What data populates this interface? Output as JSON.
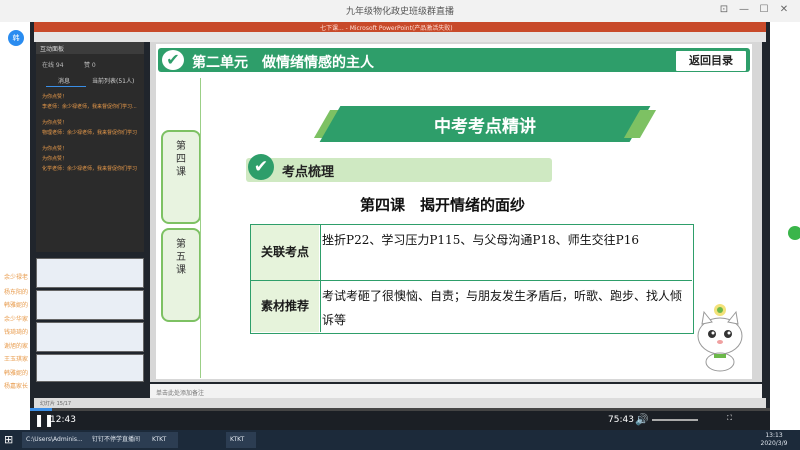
{
  "window": {
    "title": "九年级物化政史班级群直播",
    "pin": "⊡",
    "min": "—",
    "max": "☐",
    "close": "✕"
  },
  "user_avatar": "韩",
  "ppt": {
    "title": "七下课... - Microsoft PowerPoint(产品激活失败)"
  },
  "chat": {
    "header": "互动面板",
    "stats": {
      "users": "在线 94",
      "likes": "赞 0"
    },
    "tabs": [
      "消息",
      "当前列表(51人)"
    ],
    "messages": [
      "为你点赞！",
      "李老师：余少禄老师，我来督促你们学习...",
      "为你点赞！",
      "物理老师：余少禄老师，我来督促你们学习",
      "为你点赞！",
      "为你点赞！",
      "化学老师：余少禄老师，我来督促你们学习"
    ]
  },
  "slide": {
    "banner_title": "第二单元　做情绪情感的主人",
    "back_button": "返回目录",
    "tabs": [
      "第四课",
      "第五课"
    ],
    "heading": "中考考点精讲",
    "subheading": "考点梳理",
    "lesson_title": "第四课　揭开情绪的面纱",
    "table": {
      "rows": [
        {
          "header": "关联考点",
          "content": "挫折P22、学习压力P115、与父母沟通P18、师生交往P16"
        },
        {
          "header": "素材推荐",
          "content": "考试考砸了很懊恼、自责；与朋友发生矛盾后，听歌、跑步、找人倾诉等"
        }
      ]
    }
  },
  "notes": {
    "placeholder": "单击此处添加备注"
  },
  "statusbar": {
    "text": "幻灯片 15/17　"
  },
  "comments": {
    "names": [
      "余少禄老",
      "杨东阳的",
      "韩雅妮的",
      "余少华家",
      "钱琦琦的",
      "谢旭的家",
      "王玉琪家",
      "韩雅妮的",
      "杨嘉家长"
    ]
  },
  "player": {
    "current_time": "12:43",
    "total_time": "75:43",
    "progress": 0.03
  },
  "taskbar": {
    "items": [
      "C:\\Users\\Adminis...",
      "",
      "",
      "钉钉不停学直播间",
      "KTKT",
      "",
      "KTKT"
    ],
    "time": "13:13",
    "date": "2020/3/9"
  },
  "colors": {
    "accent_green": "#2e9e6a",
    "light_green": "#7dc163",
    "player_bg": "#20252c"
  }
}
